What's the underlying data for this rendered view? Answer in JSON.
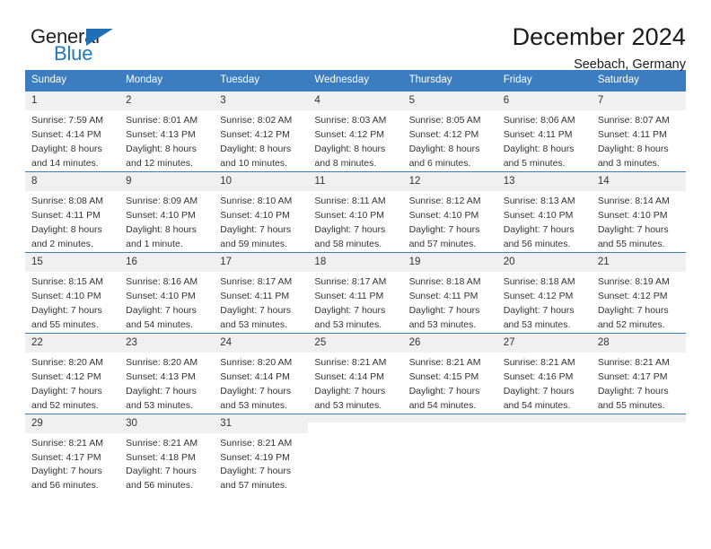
{
  "brand": {
    "name_top": "General",
    "name_bottom": "Blue",
    "flag_icon": "blue-flag-triangle",
    "accent_color": "#1f7ac0"
  },
  "header": {
    "title": "December 2024",
    "subtitle": "Seebach, Germany"
  },
  "theme": {
    "header_blue": "#3b7dbf",
    "daynum_bg": "#f0f0f0",
    "text": "#333333"
  },
  "weekdays": [
    "Sunday",
    "Monday",
    "Tuesday",
    "Wednesday",
    "Thursday",
    "Friday",
    "Saturday"
  ],
  "weeks": [
    [
      {
        "day": "1",
        "sunrise": "Sunrise: 7:59 AM",
        "sunset": "Sunset: 4:14 PM",
        "daylight1": "Daylight: 8 hours",
        "daylight2": "and 14 minutes."
      },
      {
        "day": "2",
        "sunrise": "Sunrise: 8:01 AM",
        "sunset": "Sunset: 4:13 PM",
        "daylight1": "Daylight: 8 hours",
        "daylight2": "and 12 minutes."
      },
      {
        "day": "3",
        "sunrise": "Sunrise: 8:02 AM",
        "sunset": "Sunset: 4:12 PM",
        "daylight1": "Daylight: 8 hours",
        "daylight2": "and 10 minutes."
      },
      {
        "day": "4",
        "sunrise": "Sunrise: 8:03 AM",
        "sunset": "Sunset: 4:12 PM",
        "daylight1": "Daylight: 8 hours",
        "daylight2": "and 8 minutes."
      },
      {
        "day": "5",
        "sunrise": "Sunrise: 8:05 AM",
        "sunset": "Sunset: 4:12 PM",
        "daylight1": "Daylight: 8 hours",
        "daylight2": "and 6 minutes."
      },
      {
        "day": "6",
        "sunrise": "Sunrise: 8:06 AM",
        "sunset": "Sunset: 4:11 PM",
        "daylight1": "Daylight: 8 hours",
        "daylight2": "and 5 minutes."
      },
      {
        "day": "7",
        "sunrise": "Sunrise: 8:07 AM",
        "sunset": "Sunset: 4:11 PM",
        "daylight1": "Daylight: 8 hours",
        "daylight2": "and 3 minutes."
      }
    ],
    [
      {
        "day": "8",
        "sunrise": "Sunrise: 8:08 AM",
        "sunset": "Sunset: 4:11 PM",
        "daylight1": "Daylight: 8 hours",
        "daylight2": "and 2 minutes."
      },
      {
        "day": "9",
        "sunrise": "Sunrise: 8:09 AM",
        "sunset": "Sunset: 4:10 PM",
        "daylight1": "Daylight: 8 hours",
        "daylight2": "and 1 minute."
      },
      {
        "day": "10",
        "sunrise": "Sunrise: 8:10 AM",
        "sunset": "Sunset: 4:10 PM",
        "daylight1": "Daylight: 7 hours",
        "daylight2": "and 59 minutes."
      },
      {
        "day": "11",
        "sunrise": "Sunrise: 8:11 AM",
        "sunset": "Sunset: 4:10 PM",
        "daylight1": "Daylight: 7 hours",
        "daylight2": "and 58 minutes."
      },
      {
        "day": "12",
        "sunrise": "Sunrise: 8:12 AM",
        "sunset": "Sunset: 4:10 PM",
        "daylight1": "Daylight: 7 hours",
        "daylight2": "and 57 minutes."
      },
      {
        "day": "13",
        "sunrise": "Sunrise: 8:13 AM",
        "sunset": "Sunset: 4:10 PM",
        "daylight1": "Daylight: 7 hours",
        "daylight2": "and 56 minutes."
      },
      {
        "day": "14",
        "sunrise": "Sunrise: 8:14 AM",
        "sunset": "Sunset: 4:10 PM",
        "daylight1": "Daylight: 7 hours",
        "daylight2": "and 55 minutes."
      }
    ],
    [
      {
        "day": "15",
        "sunrise": "Sunrise: 8:15 AM",
        "sunset": "Sunset: 4:10 PM",
        "daylight1": "Daylight: 7 hours",
        "daylight2": "and 55 minutes."
      },
      {
        "day": "16",
        "sunrise": "Sunrise: 8:16 AM",
        "sunset": "Sunset: 4:10 PM",
        "daylight1": "Daylight: 7 hours",
        "daylight2": "and 54 minutes."
      },
      {
        "day": "17",
        "sunrise": "Sunrise: 8:17 AM",
        "sunset": "Sunset: 4:11 PM",
        "daylight1": "Daylight: 7 hours",
        "daylight2": "and 53 minutes."
      },
      {
        "day": "18",
        "sunrise": "Sunrise: 8:17 AM",
        "sunset": "Sunset: 4:11 PM",
        "daylight1": "Daylight: 7 hours",
        "daylight2": "and 53 minutes."
      },
      {
        "day": "19",
        "sunrise": "Sunrise: 8:18 AM",
        "sunset": "Sunset: 4:11 PM",
        "daylight1": "Daylight: 7 hours",
        "daylight2": "and 53 minutes."
      },
      {
        "day": "20",
        "sunrise": "Sunrise: 8:18 AM",
        "sunset": "Sunset: 4:12 PM",
        "daylight1": "Daylight: 7 hours",
        "daylight2": "and 53 minutes."
      },
      {
        "day": "21",
        "sunrise": "Sunrise: 8:19 AM",
        "sunset": "Sunset: 4:12 PM",
        "daylight1": "Daylight: 7 hours",
        "daylight2": "and 52 minutes."
      }
    ],
    [
      {
        "day": "22",
        "sunrise": "Sunrise: 8:20 AM",
        "sunset": "Sunset: 4:12 PM",
        "daylight1": "Daylight: 7 hours",
        "daylight2": "and 52 minutes."
      },
      {
        "day": "23",
        "sunrise": "Sunrise: 8:20 AM",
        "sunset": "Sunset: 4:13 PM",
        "daylight1": "Daylight: 7 hours",
        "daylight2": "and 53 minutes."
      },
      {
        "day": "24",
        "sunrise": "Sunrise: 8:20 AM",
        "sunset": "Sunset: 4:14 PM",
        "daylight1": "Daylight: 7 hours",
        "daylight2": "and 53 minutes."
      },
      {
        "day": "25",
        "sunrise": "Sunrise: 8:21 AM",
        "sunset": "Sunset: 4:14 PM",
        "daylight1": "Daylight: 7 hours",
        "daylight2": "and 53 minutes."
      },
      {
        "day": "26",
        "sunrise": "Sunrise: 8:21 AM",
        "sunset": "Sunset: 4:15 PM",
        "daylight1": "Daylight: 7 hours",
        "daylight2": "and 54 minutes."
      },
      {
        "day": "27",
        "sunrise": "Sunrise: 8:21 AM",
        "sunset": "Sunset: 4:16 PM",
        "daylight1": "Daylight: 7 hours",
        "daylight2": "and 54 minutes."
      },
      {
        "day": "28",
        "sunrise": "Sunrise: 8:21 AM",
        "sunset": "Sunset: 4:17 PM",
        "daylight1": "Daylight: 7 hours",
        "daylight2": "and 55 minutes."
      }
    ],
    [
      {
        "day": "29",
        "sunrise": "Sunrise: 8:21 AM",
        "sunset": "Sunset: 4:17 PM",
        "daylight1": "Daylight: 7 hours",
        "daylight2": "and 56 minutes."
      },
      {
        "day": "30",
        "sunrise": "Sunrise: 8:21 AM",
        "sunset": "Sunset: 4:18 PM",
        "daylight1": "Daylight: 7 hours",
        "daylight2": "and 56 minutes."
      },
      {
        "day": "31",
        "sunrise": "Sunrise: 8:21 AM",
        "sunset": "Sunset: 4:19 PM",
        "daylight1": "Daylight: 7 hours",
        "daylight2": "and 57 minutes."
      },
      {
        "day": "",
        "sunrise": "",
        "sunset": "",
        "daylight1": "",
        "daylight2": ""
      },
      {
        "day": "",
        "sunrise": "",
        "sunset": "",
        "daylight1": "",
        "daylight2": ""
      },
      {
        "day": "",
        "sunrise": "",
        "sunset": "",
        "daylight1": "",
        "daylight2": ""
      },
      {
        "day": "",
        "sunrise": "",
        "sunset": "",
        "daylight1": "",
        "daylight2": ""
      }
    ]
  ]
}
